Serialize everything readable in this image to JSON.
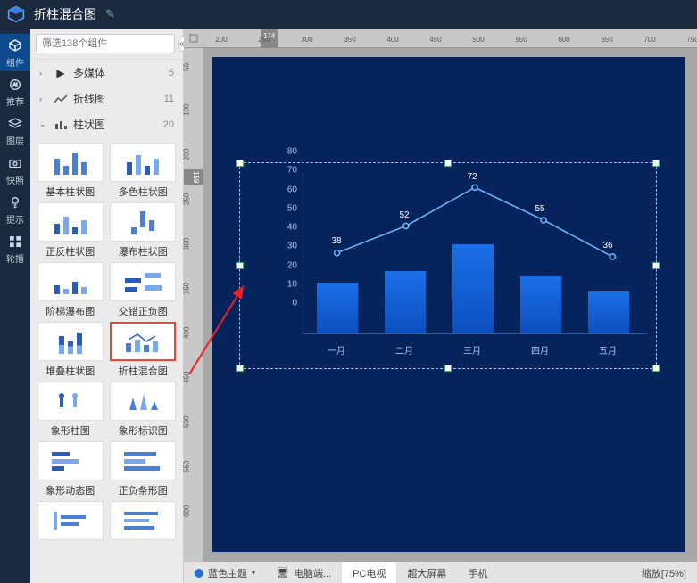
{
  "header": {
    "title": "折柱混合图"
  },
  "rail": [
    {
      "label": "组件",
      "icon": "cube"
    },
    {
      "label": "推荐",
      "icon": "ai"
    },
    {
      "label": "图层",
      "icon": "layers"
    },
    {
      "label": "快照",
      "icon": "camera"
    },
    {
      "label": "提示",
      "icon": "bulb"
    },
    {
      "label": "轮播",
      "icon": "grid"
    }
  ],
  "search": {
    "placeholder": "筛选138个组件"
  },
  "categories": [
    {
      "expanded": ">",
      "icon": "media",
      "label": "多媒体",
      "count": "5"
    },
    {
      "expanded": ">",
      "icon": "line",
      "label": "折线图",
      "count": "11"
    },
    {
      "expanded": "v",
      "icon": "bar",
      "label": "柱状图",
      "count": "20"
    }
  ],
  "thumbs": [
    {
      "label": "基本柱状图"
    },
    {
      "label": "多色柱状图"
    },
    {
      "label": "正反柱状图"
    },
    {
      "label": "瀑布柱状图"
    },
    {
      "label": "阶梯瀑布图"
    },
    {
      "label": "交错正负图"
    },
    {
      "label": "堆叠柱状图"
    },
    {
      "label": "折柱混合图"
    },
    {
      "label": "象形柱图"
    },
    {
      "label": "象形标识图"
    },
    {
      "label": "象形动态图"
    },
    {
      "label": "正负条形图"
    }
  ],
  "selected_thumb_index": 7,
  "ruler_h_ticks": [
    "200",
    "250",
    "300",
    "350",
    "400",
    "450",
    "500",
    "550",
    "600",
    "650",
    "700",
    "750"
  ],
  "ruler_h_marker": "174",
  "ruler_v_ticks": [
    "50",
    "100",
    "200",
    "250",
    "300",
    "350",
    "400",
    "450",
    "500",
    "550",
    "600"
  ],
  "ruler_v_marker": "159",
  "chart_data": {
    "type": "bar+line",
    "categories": [
      "一月",
      "二月",
      "三月",
      "四月",
      "五月"
    ],
    "series": [
      {
        "name": "bar",
        "values": [
          27,
          33,
          47,
          30,
          22
        ]
      },
      {
        "name": "line",
        "values": [
          38,
          52,
          72,
          55,
          36
        ]
      }
    ],
    "ylim": [
      0,
      80
    ],
    "y_ticks": [
      0,
      10,
      20,
      30,
      40,
      50,
      60,
      70,
      80
    ]
  },
  "bottombar": {
    "theme": "蓝色主题",
    "device_icon": "电脑端...",
    "tabs": [
      "PC电视",
      "超大屏幕",
      "手机"
    ],
    "active_tab_index": 0,
    "zoom": "缩放[75%]"
  }
}
